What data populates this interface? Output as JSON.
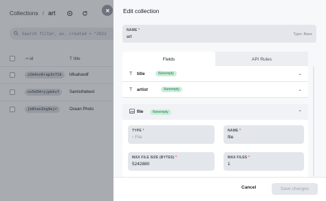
{
  "background": {
    "breadcrumb": {
      "root": "Collections",
      "separator": "/",
      "current": "art"
    },
    "search": {
      "placeholder": "Search filter, ex. created > \"2022"
    },
    "table": {
      "headers": {
        "id": "id",
        "title": "title"
      },
      "rows": [
        {
          "id": "z2b4sn6rap3s71k",
          "title": "ldfuahasdf"
        },
        {
          "id": "ov5d34ryjpbhcf",
          "title": "Samisthebest"
        },
        {
          "id": "jb8tan1hg9ejr",
          "title": "Ocean Photo"
        }
      ]
    }
  },
  "panel": {
    "title": "Edit collection",
    "name_field": {
      "label": "NAME",
      "required": "*",
      "value": "art",
      "type_tag": "Type: Base"
    },
    "tabs": [
      {
        "label": "Fields"
      },
      {
        "label": "API Rules"
      }
    ],
    "fields": [
      {
        "name": "title",
        "icon": "T",
        "badge": "Nonempty",
        "chevron": "⌄"
      },
      {
        "name": "artist",
        "icon": "T",
        "badge": "Nonempty",
        "chevron": "⌄"
      },
      {
        "name": "file",
        "badge": "Nonempty",
        "chevron": "⌃"
      }
    ],
    "file_options": {
      "type": {
        "label": "TYPE",
        "required": "*",
        "value": "File"
      },
      "name": {
        "label": "NAME",
        "required": "*",
        "value": "file"
      },
      "max_size": {
        "label": "MAX FILE SIZE (BYTES)",
        "required": "*",
        "value": "5242880"
      },
      "max_files": {
        "label": "MAX FILES",
        "required": "*",
        "value": "1"
      }
    },
    "footer": {
      "cancel": "Cancel",
      "save": "Save changes"
    }
  },
  "colors": {
    "badge_bg": "#cdeedd",
    "badge_text": "#1d7a4a",
    "required": "#e34562"
  }
}
